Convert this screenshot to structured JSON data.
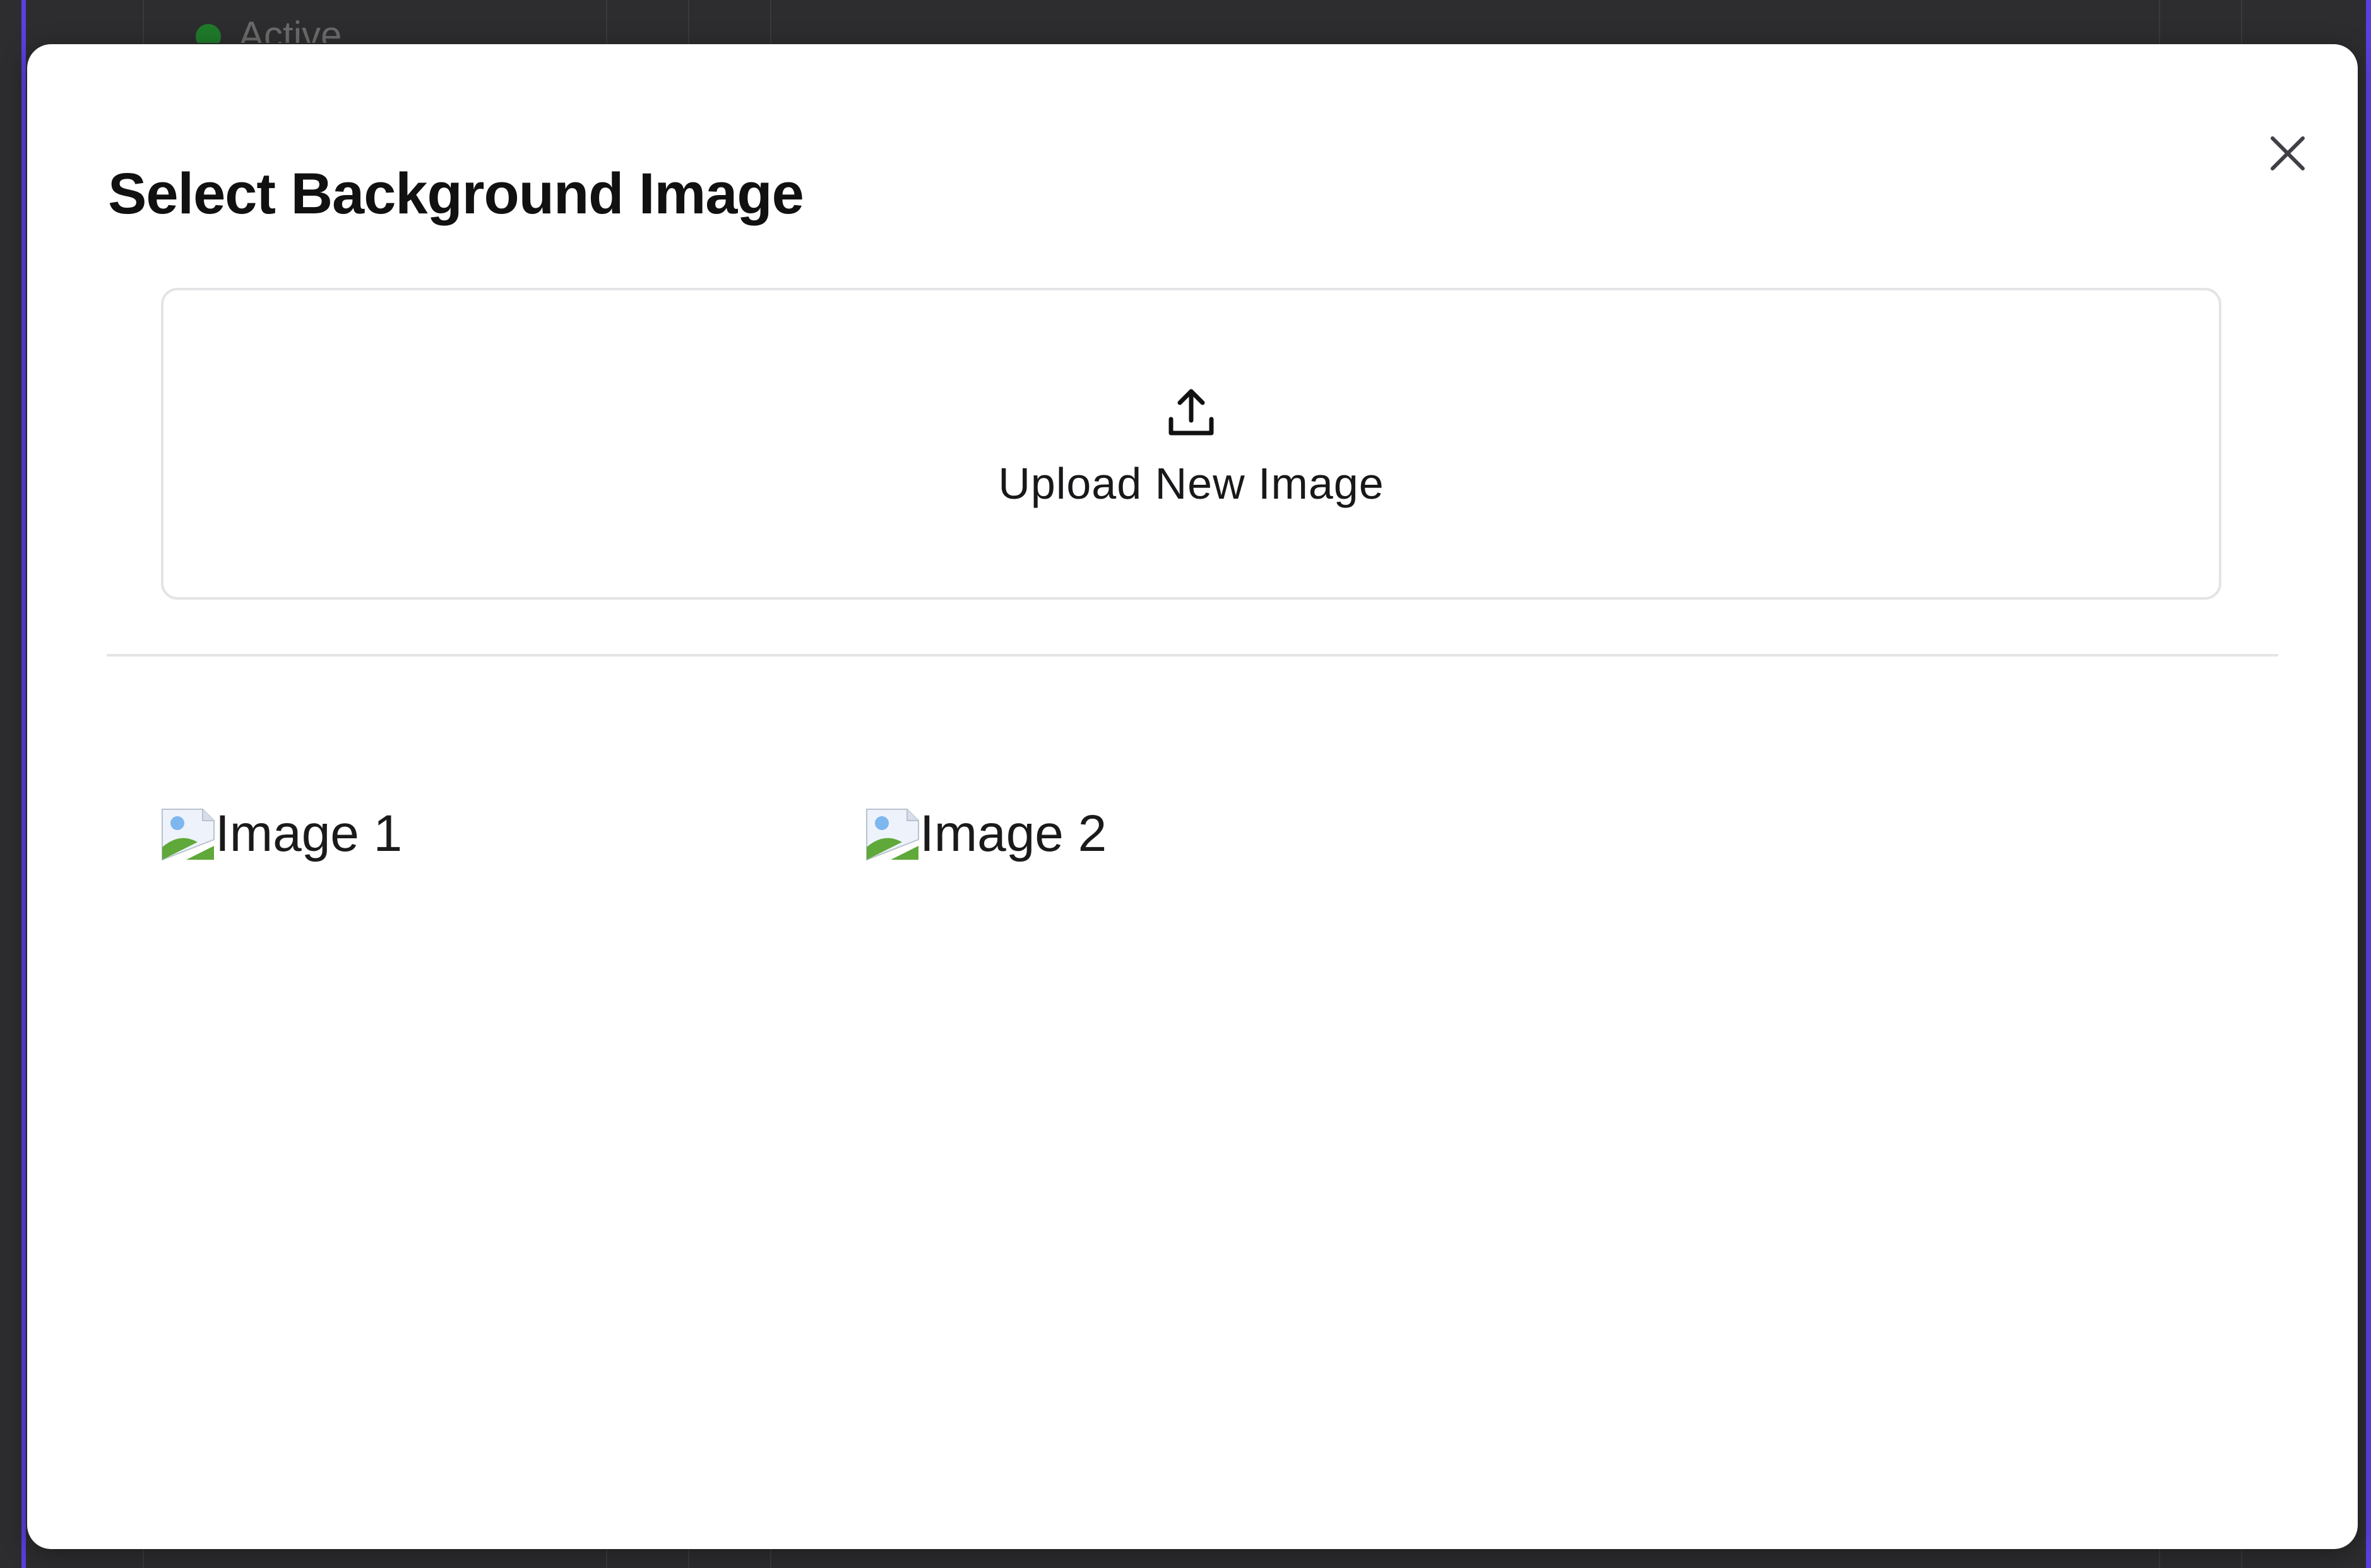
{
  "background": {
    "status_text": "Active"
  },
  "modal": {
    "title": "Select Background Image",
    "close_label": "×",
    "upload": {
      "label": "Upload New Image",
      "icon": "upload-icon"
    },
    "images": [
      {
        "alt": "Image 1",
        "icon": "broken-image-icon"
      },
      {
        "alt": "Image 2",
        "icon": "broken-image-icon"
      }
    ]
  },
  "colors": {
    "accent": "#5b3fe0",
    "backdrop": "#2d2d2f",
    "modal_bg": "#ffffff",
    "border": "#e4e4e7",
    "status_green": "#1f7a2a"
  }
}
